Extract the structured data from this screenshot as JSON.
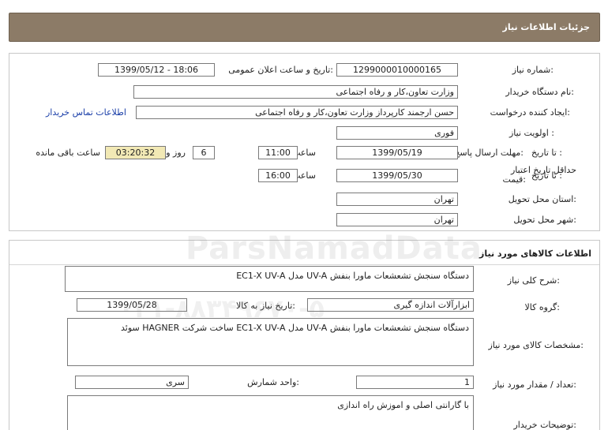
{
  "header": {
    "title": "جزئیات اطلاعات نیاز"
  },
  "info": {
    "need_number_label": "شماره نیاز:",
    "need_number": "1299000010000165",
    "announce_label": "تاریخ و ساعت اعلان عمومی:",
    "announce_value": "1399/05/12 - 18:06",
    "buyer_org_label": "نام دستگاه خریدار:",
    "buyer_org": "وزارت تعاون،کار و رفاه اجتماعی",
    "requester_label": "ایجاد کننده درخواست:",
    "requester": "حسن ارجمند کارپرداز وزارت تعاون،کار و رفاه اجتماعی",
    "contact_link": "اطلاعات تماس خریدار",
    "priority_label": "اولویت نیاز :",
    "priority": "فوری",
    "deadline_label": "مهلت ارسال پاسخ:",
    "to_date_label": "تا تاریخ :",
    "deadline_date": "1399/05/19",
    "time_label": "ساعت",
    "deadline_time": "11:00",
    "days_value": "6",
    "days_label": "روز و",
    "remaining_time": "03:20:32",
    "remaining_label": "ساعت باقی مانده",
    "validity_label_1": "حداقل تاریخ اعتبار",
    "validity_label_2": "قیمت:",
    "validity_date": "1399/05/30",
    "validity_time": "16:00",
    "province_label": "استان محل تحویل:",
    "province": "تهران",
    "city_label": "شهر محل تحویل:",
    "city": "تهران"
  },
  "goods": {
    "section_title": "اطلاعات کالاهای مورد نیاز",
    "summary_label": "شرح کلی نیاز:",
    "summary": "دستگاه سنجش تشعشعات ماورا بنفش UV-A مدل EC1-X UV-A",
    "group_label": "گروه کالا:",
    "group": "ابزارآلات اندازه گیری",
    "need_date_label": "تاریخ نیاز به کالا:",
    "need_date": "1399/05/28",
    "spec_label": "مشخصات کالای مورد نیاز:",
    "spec": "دستگاه سنجش تشعشعات ماورا بنفش UV-A مدل EC1-X UV-A   ساخت شرکت HAGNER سوئد",
    "qty_label": "تعداد / مقدار مورد نیاز:",
    "qty": "1",
    "unit_label": "واحد شمارش:",
    "unit": "سری",
    "buyer_notes_label": "توضیحات خریدار:",
    "buyer_notes": "با گارانتی اصلی و اموزش راه اندازی"
  },
  "watermark": {
    "brand": "ParsNamadData",
    "phone": "۰۲۱-۸۸۳۴۹۶۷۰-۵"
  },
  "colors": {
    "header_bg": "#8c7b67",
    "highlight_bg": "#f2e9b5",
    "link": "#1a3ea8"
  }
}
